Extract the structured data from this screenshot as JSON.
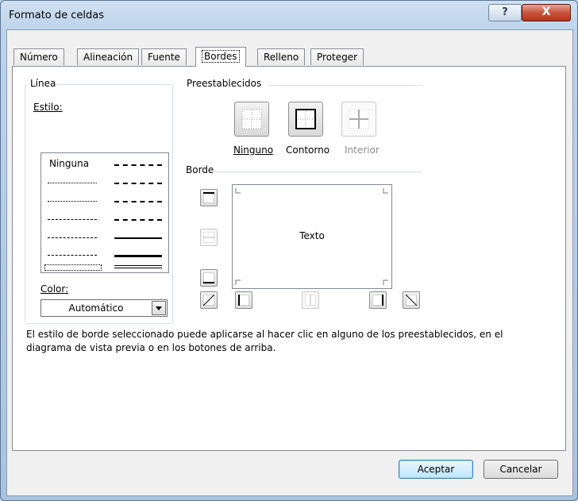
{
  "window": {
    "title": "Formato de celdas",
    "help_label": "?",
    "close_label": "X"
  },
  "tabs": [
    {
      "label": "Número"
    },
    {
      "label": "Alineación"
    },
    {
      "label": "Fuente"
    },
    {
      "label": "Bordes",
      "active": true
    },
    {
      "label": "Relleno"
    },
    {
      "label": "Proteger"
    }
  ],
  "linea": {
    "group_label": "Línea",
    "estilo_label": "Estilo:",
    "none_option": "Ninguna",
    "color_label": "Color:",
    "color_value": "Automático"
  },
  "presets": {
    "group_label": "Preestablecidos",
    "none": "Ninguno",
    "outline": "Contorno",
    "inside": "Interior"
  },
  "border": {
    "group_label": "Borde",
    "preview_text": "Texto"
  },
  "description": "El estilo de borde seleccionado puede aplicarse al hacer clic en alguno de los preestablecidos, en el diagrama de vista previa o en los botones de arriba.",
  "buttons": {
    "ok": "Aceptar",
    "cancel": "Cancelar"
  },
  "colors": {
    "title_bar": "#bcd3ea",
    "close_button": "#c8553f",
    "dialog_bg": "#f0f0f0",
    "default_button": "#bee6fd"
  }
}
